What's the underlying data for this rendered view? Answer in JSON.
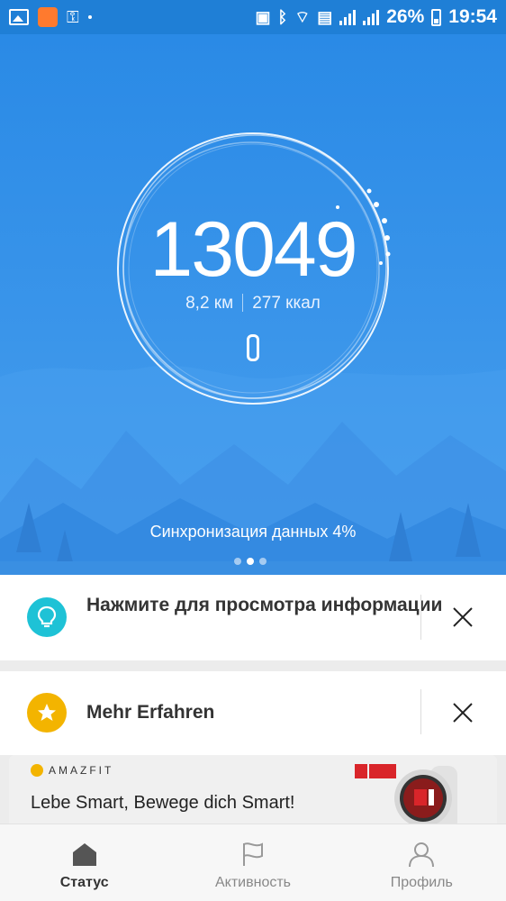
{
  "status_bar": {
    "battery_percent": "26%",
    "time": "19:54",
    "icons": [
      "gallery-icon",
      "app-notification-icon",
      "key-icon",
      "dot-icon",
      "battery-saver-icon",
      "bluetooth-icon",
      "wifi-icon",
      "sim-icon",
      "signal-icon",
      "signal-icon",
      "battery-icon"
    ]
  },
  "activity": {
    "steps": "13049",
    "distance": "8,2 км",
    "calories": "277 ккал",
    "sync_status": "Синхронизация данных 4%",
    "page_dots": 3,
    "active_page": 1
  },
  "cards": [
    {
      "text": "Нажмите для просмотра информации",
      "icon": "lightbulb-icon",
      "icon_color": "#1ec2d6"
    },
    {
      "text": "Mehr Erfahren",
      "icon": "star-icon",
      "icon_color": "#f3b400"
    }
  ],
  "ad": {
    "brand": "AMAZFIT",
    "tagline": "Lebe Smart, Bewege dich Smart!"
  },
  "nav": [
    {
      "label": "Статус",
      "icon": "home-icon",
      "active": true
    },
    {
      "label": "Активность",
      "icon": "flag-icon",
      "active": false
    },
    {
      "label": "Профиль",
      "icon": "profile-icon",
      "active": false
    }
  ],
  "colors": {
    "hero_blue": "#2a8ae6",
    "accent_cyan": "#1ec2d6",
    "accent_yellow": "#f3b400"
  }
}
